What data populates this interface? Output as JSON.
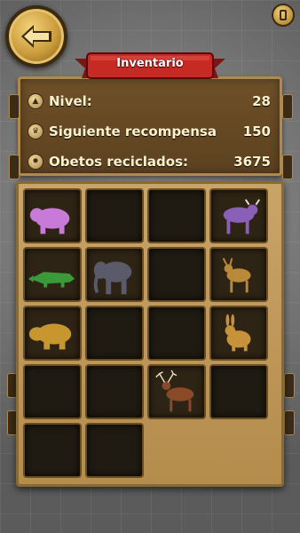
{
  "header": {
    "title": "Inventario",
    "back_icon": "arrow-left-icon",
    "top_right_icon": "pause-icon"
  },
  "stats": [
    {
      "label": "Nivel:",
      "value": "28",
      "icon": "level-icon"
    },
    {
      "label": "Siguiente recompensa",
      "value": "150",
      "icon": "trophy-icon"
    },
    {
      "label": "Obetos reciclados:",
      "value": "3675",
      "icon": "gear-icon"
    }
  ],
  "inventory": {
    "items": [
      {
        "slot": 1,
        "animal": "bear",
        "color": "#c77ad8"
      },
      {
        "slot": 2,
        "animal": null
      },
      {
        "slot": 3,
        "animal": null
      },
      {
        "slot": 4,
        "animal": "bull",
        "color": "#8a5fb8"
      },
      {
        "slot": 5,
        "animal": "crocodile",
        "color": "#3a9a3a"
      },
      {
        "slot": 6,
        "animal": "elephant",
        "color": "#5a5a6a"
      },
      {
        "slot": 7,
        "animal": null
      },
      {
        "slot": 8,
        "animal": "goat",
        "color": "#b88a3a"
      },
      {
        "slot": 9,
        "animal": "hippo",
        "color": "#c8962e"
      },
      {
        "slot": 10,
        "animal": null
      },
      {
        "slot": 11,
        "animal": null
      },
      {
        "slot": 12,
        "animal": "rabbit",
        "color": "#c8923a"
      },
      {
        "slot": 13,
        "animal": null
      },
      {
        "slot": 14,
        "animal": null
      },
      {
        "slot": 15,
        "animal": "deer",
        "color": "#8a4a28"
      },
      {
        "slot": 16,
        "animal": null
      },
      {
        "slot": 17,
        "animal": null
      },
      {
        "slot": 18,
        "animal": null
      }
    ]
  }
}
